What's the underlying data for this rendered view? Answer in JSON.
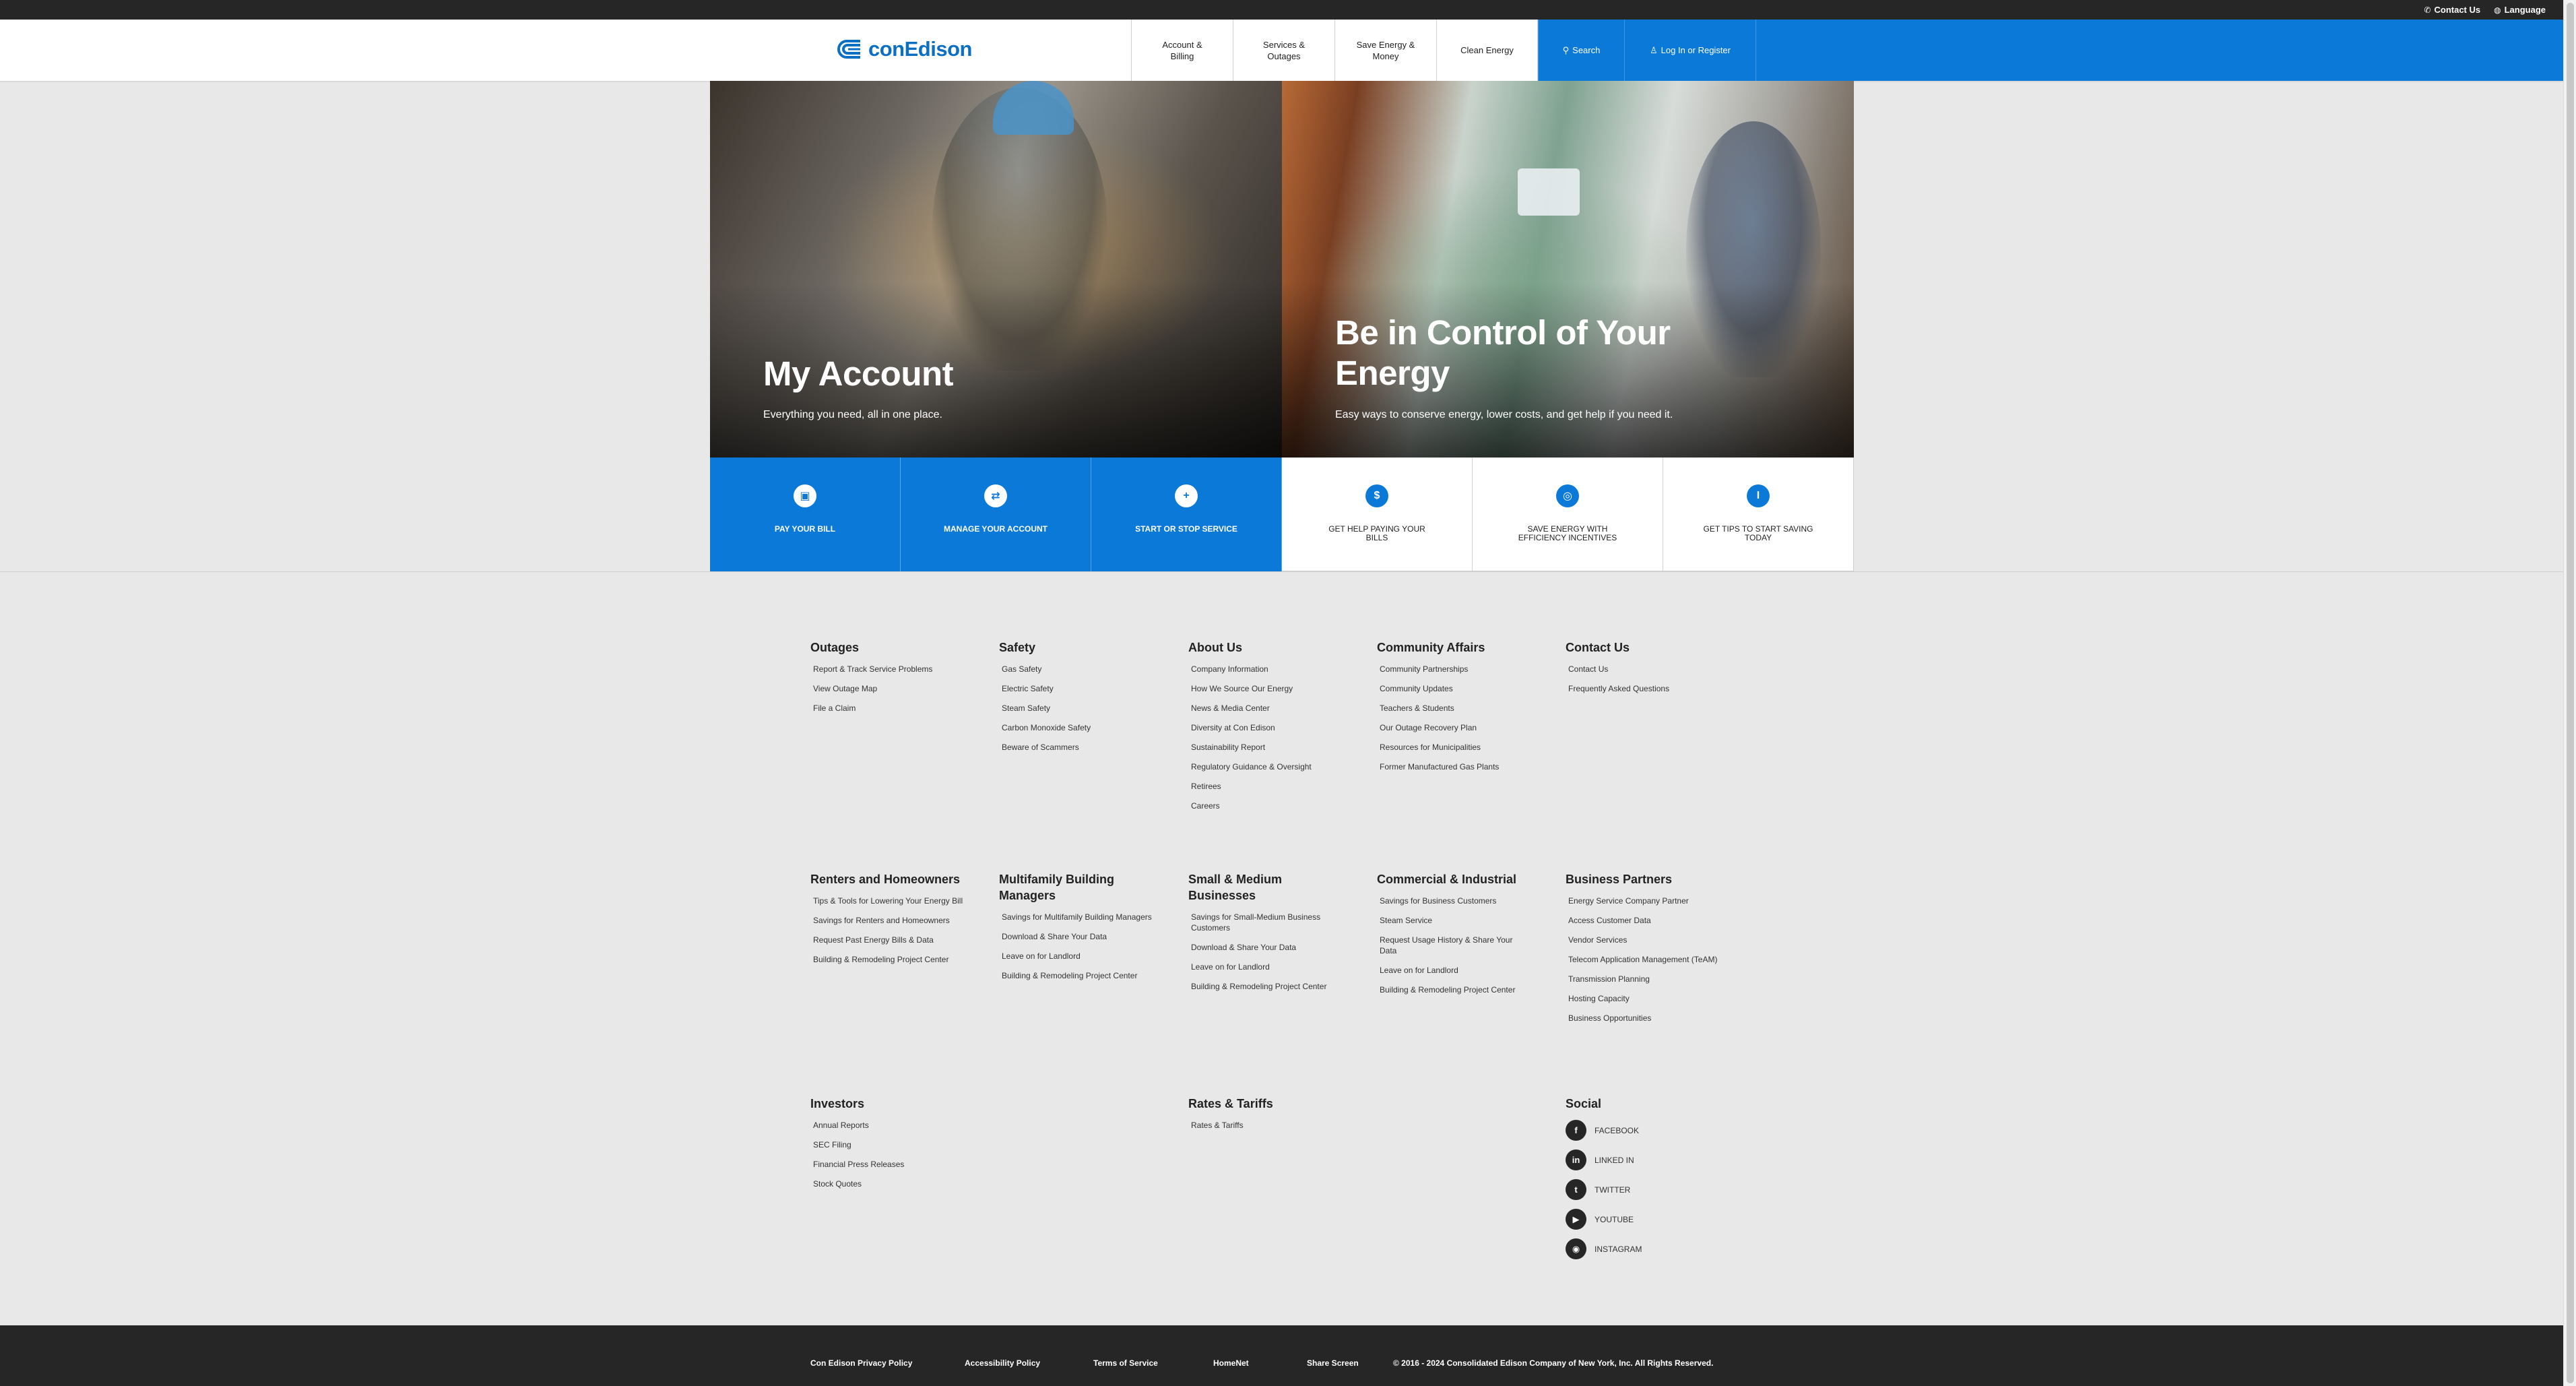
{
  "utility": {
    "contact": "Contact Us",
    "language": "Language"
  },
  "header": {
    "logo_text": "conEdison",
    "nav": [
      {
        "label": "Account &\nBilling"
      },
      {
        "label": "Services &\nOutages"
      },
      {
        "label": "Save Energy &\nMoney"
      },
      {
        "label": "Clean Energy"
      }
    ],
    "search": "Search",
    "login": "Log In or Register"
  },
  "hero": {
    "left": {
      "title": "My Account",
      "subtitle": "Everything you need, all in one place."
    },
    "right": {
      "title": "Be in Control of Your Energy",
      "subtitle": "Easy ways to conserve energy, lower costs, and get help if you need it."
    }
  },
  "tiles": [
    {
      "label": "PAY YOUR BILL",
      "icon": "bill-icon",
      "glyph": "▣"
    },
    {
      "label": "MANAGE YOUR ACCOUNT",
      "icon": "account-icon",
      "glyph": "⇄"
    },
    {
      "label": "START OR STOP SERVICE",
      "icon": "power-icon",
      "glyph": "+"
    },
    {
      "label": "GET HELP PAYING YOUR BILLS",
      "icon": "dollar-icon",
      "glyph": "$"
    },
    {
      "label": "SAVE ENERGY WITH EFFICIENCY INCENTIVES",
      "icon": "piggy-bank-icon",
      "glyph": "◎"
    },
    {
      "label": "GET TIPS TO START SAVING TODAY",
      "icon": "thermometer-icon",
      "glyph": "I"
    }
  ],
  "footer": {
    "outages": {
      "title": "Outages",
      "links": [
        "Report & Track Service Problems",
        "View Outage Map",
        "File a Claim"
      ]
    },
    "safety": {
      "title": "Safety",
      "links": [
        "Gas Safety",
        "Electric Safety",
        "Steam Safety",
        "Carbon Monoxide Safety",
        "Beware of Scammers"
      ]
    },
    "about": {
      "title": "About Us",
      "links": [
        "Company Information",
        "How We Source Our Energy",
        "News & Media Center",
        "Diversity at Con Edison",
        "Sustainability Report",
        "Regulatory Guidance & Oversight",
        "Retirees",
        "Careers"
      ]
    },
    "community": {
      "title": "Community Affairs",
      "links": [
        "Community Partnerships",
        "Community Updates",
        "Teachers & Students",
        "Our Outage Recovery Plan",
        "Resources for Municipalities",
        "Former Manufactured Gas Plants"
      ]
    },
    "contact": {
      "title": "Contact Us",
      "links": [
        "Contact Us",
        "Frequently Asked Questions"
      ]
    },
    "renters": {
      "title": "Renters and Homeowners",
      "links": [
        "Tips & Tools for Lowering Your Energy Bill",
        "Savings for Renters and Homeowners",
        "Request Past Energy Bills & Data",
        "Building & Remodeling Project Center"
      ]
    },
    "multifamily": {
      "title": "Multifamily Building Managers",
      "links": [
        "Savings for Multifamily Building Managers",
        "Download & Share Your Data",
        "Leave on for Landlord",
        "Building & Remodeling Project Center"
      ]
    },
    "small": {
      "title": "Small & Medium Businesses",
      "links": [
        "Savings for Small-Medium Business Customers",
        "Download & Share Your Data",
        "Leave on for Landlord",
        "Building & Remodeling Project Center"
      ]
    },
    "commercial": {
      "title": "Commercial & Industrial",
      "links": [
        "Savings for Business Customers",
        "Steam Service",
        "Request Usage History & Share Your Data",
        "Leave on for Landlord",
        "Building & Remodeling Project Center"
      ]
    },
    "partners": {
      "title": "Business Partners",
      "links": [
        "Energy Service Company Partner",
        "Access Customer Data",
        "Vendor Services",
        "Telecom Application Management (TeAM)",
        "Transmission Planning",
        "Hosting Capacity",
        "Business Opportunities"
      ]
    },
    "investors": {
      "title": "Investors",
      "links": [
        "Annual Reports",
        "SEC Filing",
        "Financial Press Releases",
        "Stock Quotes"
      ]
    },
    "rates": {
      "title": "Rates & Tariffs",
      "links": [
        "Rates & Tariffs"
      ]
    },
    "social": {
      "title": "Social",
      "items": [
        {
          "label": "FACEBOOK",
          "icon": "facebook-icon",
          "glyph": "f"
        },
        {
          "label": "LINKED IN",
          "icon": "linkedin-icon",
          "glyph": "in"
        },
        {
          "label": "TWITTER",
          "icon": "twitter-icon",
          "glyph": "t"
        },
        {
          "label": "YOUTUBE",
          "icon": "youtube-icon",
          "glyph": "▶"
        },
        {
          "label": "INSTAGRAM",
          "icon": "instagram-icon",
          "glyph": "◉"
        }
      ]
    }
  },
  "bottom": {
    "privacy": "Con Edison Privacy Policy",
    "accessibility": "Accessibility Policy",
    "terms": "Terms of Service",
    "homenet": "HomeNet",
    "share": "Share Screen",
    "copyright": "© 2016 - 2024 Consolidated Edison Company of New York, Inc. All Rights Reserved."
  },
  "colors": {
    "brand_blue": "#0b79d7",
    "dark": "#262626"
  }
}
